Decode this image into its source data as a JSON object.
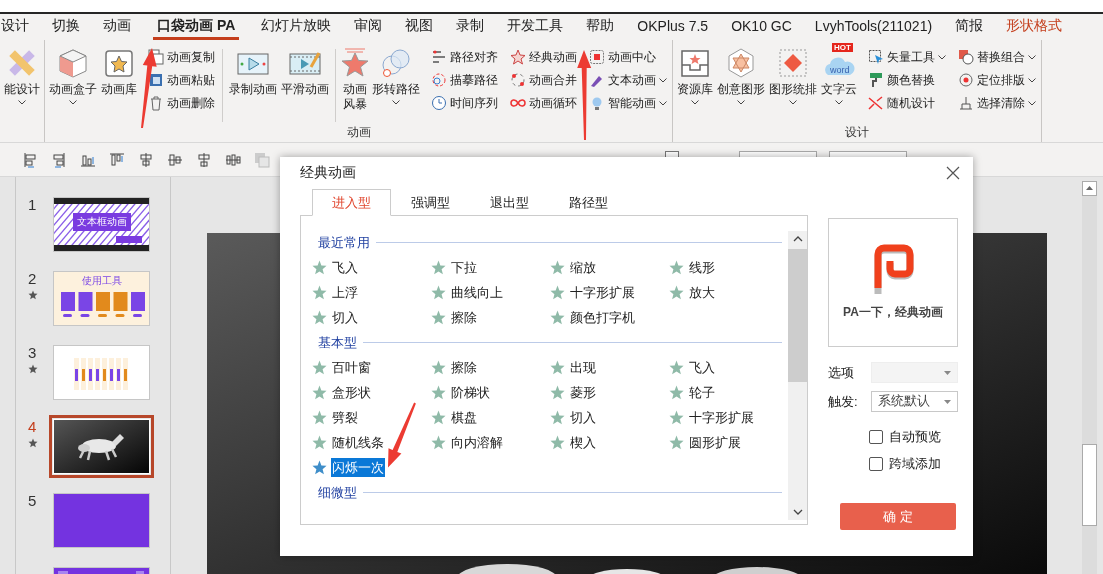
{
  "ribbon_tabs": [
    {
      "label": "设计",
      "selected": false,
      "kind": "normal"
    },
    {
      "label": "切换",
      "selected": false,
      "kind": "normal"
    },
    {
      "label": "动画",
      "selected": false,
      "kind": "normal"
    },
    {
      "label": "口袋动画 PA",
      "selected": true,
      "kind": "normal"
    },
    {
      "label": "幻灯片放映",
      "selected": false,
      "kind": "normal"
    },
    {
      "label": "审阅",
      "selected": false,
      "kind": "normal"
    },
    {
      "label": "视图",
      "selected": false,
      "kind": "normal"
    },
    {
      "label": "录制",
      "selected": false,
      "kind": "normal"
    },
    {
      "label": "开发工具",
      "selected": false,
      "kind": "normal"
    },
    {
      "label": "帮助",
      "selected": false,
      "kind": "normal"
    },
    {
      "label": "OKPlus 7.5",
      "selected": false,
      "kind": "normal"
    },
    {
      "label": "OK10 GC",
      "selected": false,
      "kind": "normal"
    },
    {
      "label": "LvyhTools(211021)",
      "selected": false,
      "kind": "normal"
    },
    {
      "label": "简报",
      "selected": false,
      "kind": "normal"
    },
    {
      "label": "形状格式",
      "selected": false,
      "kind": "contextual"
    }
  ],
  "ribbon": [
    {
      "items": [
        {
          "kind": "large",
          "label": "能设计",
          "dropdown": true
        }
      ]
    },
    {
      "label": "动画",
      "items": [
        {
          "kind": "large",
          "label": "动画盒子",
          "dropdown": true
        },
        {
          "kind": "large",
          "label": "动画库",
          "dropdown": false
        },
        {
          "kind": "stack",
          "buttons": [
            {
              "label": "动画复制",
              "dropdown": false
            },
            {
              "label": "动画粘贴",
              "dropdown": false
            },
            {
              "label": "动画删除",
              "dropdown": false
            }
          ]
        },
        {
          "kind": "separator"
        },
        {
          "kind": "large",
          "label": "录制动画",
          "dropdown": false
        },
        {
          "kind": "large",
          "label": "平滑动画",
          "dropdown": false
        },
        {
          "kind": "separator"
        },
        {
          "kind": "narrow",
          "label": "动画风暴",
          "dropdown": false
        },
        {
          "kind": "large",
          "label": "形转路径",
          "dropdown": true
        },
        {
          "kind": "stack",
          "buttons": [
            {
              "label": "路径对齐",
              "dropdown": false
            },
            {
              "label": "描摹路径",
              "dropdown": false
            },
            {
              "label": "时间序列",
              "dropdown": false
            }
          ]
        },
        {
          "kind": "stack",
          "buttons": [
            {
              "label": "经典动画",
              "dropdown": false
            },
            {
              "label": "动画合并",
              "dropdown": false
            },
            {
              "label": "动画循环",
              "dropdown": false
            }
          ]
        },
        {
          "kind": "stack",
          "buttons": [
            {
              "label": "动画中心",
              "dropdown": false
            },
            {
              "label": "文本动画",
              "dropdown": true
            },
            {
              "label": "智能动画",
              "dropdown": true
            }
          ]
        }
      ]
    },
    {
      "label": "设计",
      "items": [
        {
          "kind": "large",
          "label": "资源库",
          "dropdown": true
        },
        {
          "kind": "large",
          "label": "创意图形",
          "dropdown": true
        },
        {
          "kind": "large",
          "label": "图形统排",
          "dropdown": true
        },
        {
          "kind": "large",
          "label": "文字云",
          "dropdown": true,
          "badge": "HOT",
          "icon_text": "word"
        },
        {
          "kind": "stack",
          "buttons": [
            {
              "label": "矢量工具",
              "dropdown": true
            },
            {
              "label": "颜色替换",
              "dropdown": false
            },
            {
              "label": "随机设计",
              "dropdown": false
            }
          ]
        },
        {
          "kind": "stack",
          "buttons": [
            {
              "label": "替换组合",
              "dropdown": true
            },
            {
              "label": "定位排版",
              "dropdown": true
            },
            {
              "label": "选择清除",
              "dropdown": true
            }
          ]
        }
      ]
    }
  ],
  "toolbar": {
    "guides": {
      "checked": false
    }
  },
  "slides": [
    {
      "number": "1",
      "selected": false,
      "starred": false,
      "kind": "title",
      "title": "文本框动画"
    },
    {
      "number": "2",
      "selected": false,
      "starred": true,
      "kind": "cards",
      "title": "使用工具"
    },
    {
      "number": "3",
      "selected": false,
      "starred": true,
      "kind": "bars"
    },
    {
      "number": "4",
      "selected": true,
      "starred": true,
      "kind": "picture"
    },
    {
      "number": "5",
      "selected": false,
      "starred": false,
      "kind": "blank"
    },
    {
      "selected": false,
      "starred": false,
      "kind": "banner"
    }
  ],
  "dialog": {
    "title": "经典动画",
    "tabs": [
      {
        "label": "进入型",
        "selected": true
      },
      {
        "label": "强调型",
        "selected": false
      },
      {
        "label": "退出型",
        "selected": false
      },
      {
        "label": "路径型",
        "selected": false
      }
    ],
    "sections": [
      {
        "heading": "最近常用",
        "effects": [
          {
            "label": "飞入",
            "selected": false
          },
          {
            "label": "下拉",
            "selected": false
          },
          {
            "label": "缩放",
            "selected": false
          },
          {
            "label": "线形",
            "selected": false
          },
          {
            "label": "上浮",
            "selected": false
          },
          {
            "label": "曲线向上",
            "selected": false
          },
          {
            "label": "十字形扩展",
            "selected": false
          },
          {
            "label": "放大",
            "selected": false
          },
          {
            "label": "切入",
            "selected": false
          },
          {
            "label": "擦除",
            "selected": false
          },
          {
            "label": "颜色打字机",
            "selected": false
          }
        ]
      },
      {
        "heading": "基本型",
        "effects": [
          {
            "label": "百叶窗",
            "selected": false
          },
          {
            "label": "擦除",
            "selected": false
          },
          {
            "label": "出现",
            "selected": false
          },
          {
            "label": "飞入",
            "selected": false
          },
          {
            "label": "盒形状",
            "selected": false
          },
          {
            "label": "阶梯状",
            "selected": false
          },
          {
            "label": "菱形",
            "selected": false
          },
          {
            "label": "轮子",
            "selected": false
          },
          {
            "label": "劈裂",
            "selected": false
          },
          {
            "label": "棋盘",
            "selected": false
          },
          {
            "label": "切入",
            "selected": false
          },
          {
            "label": "十字形扩展",
            "selected": false
          },
          {
            "label": "随机线条",
            "selected": false
          },
          {
            "label": "向内溶解",
            "selected": false
          },
          {
            "label": "楔入",
            "selected": false
          },
          {
            "label": "圆形扩展",
            "selected": false
          },
          {
            "label": "闪烁一次",
            "selected": true
          }
        ]
      },
      {
        "heading": "细微型"
      }
    ],
    "preview": {
      "caption": "PA一下，经典动画"
    },
    "fields": [
      {
        "label": "选项",
        "disabled": true
      },
      {
        "label": "触发:",
        "value": "系统默认",
        "disabled": false
      }
    ],
    "checkboxes": [
      {
        "label": "自动预览",
        "checked": false
      },
      {
        "label": "跨域添加",
        "checked": false
      }
    ],
    "confirm": "确 定"
  }
}
